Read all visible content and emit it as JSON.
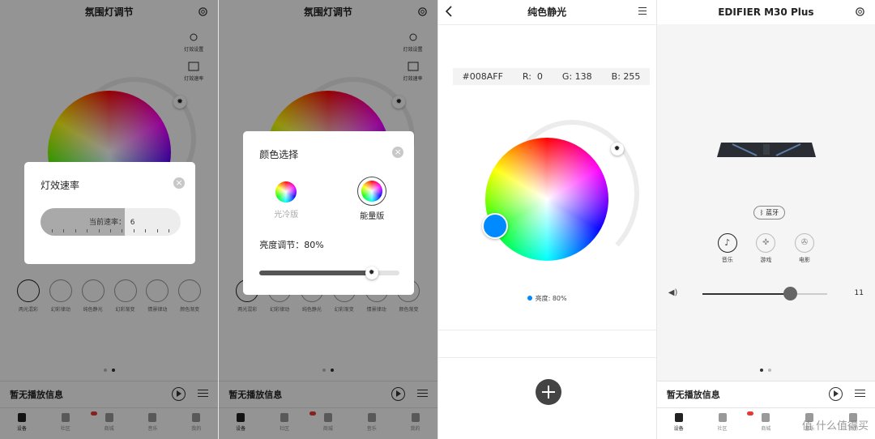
{
  "panel1": {
    "title": "氛围灯调节",
    "side_effect_label": "灯效设置",
    "side_speed_label": "灯效速率",
    "modes": [
      "两光混彩",
      "幻彩律动",
      "纯色静光",
      "幻彩渐变",
      "情景律动",
      "颜色渐变"
    ],
    "dialog": {
      "title": "灯效速率",
      "speed_label": "当前速率：",
      "speed_value": "6",
      "speed_fraction": 0.6
    },
    "player": {
      "text": "暂无播放信息"
    },
    "tabs": [
      "设备",
      "社区",
      "商城",
      "音乐",
      "我的"
    ]
  },
  "panel2": {
    "title": "氛围灯调节",
    "dialog": {
      "title": "颜色选择",
      "option_cold": "光冷版",
      "option_energy": "能量版",
      "brightness_label": "亮度调节：",
      "brightness_value": "80%",
      "brightness_fraction": 0.8
    },
    "player": {
      "text": "暂无播放信息"
    },
    "tabs": [
      "设备",
      "社区",
      "商城",
      "音乐",
      "我的"
    ]
  },
  "panel3": {
    "title": "纯色静光",
    "hex": "#008AFF",
    "r_label": "R:",
    "r_value": "0",
    "g_label": "G:",
    "g_value": "138",
    "b_label": "B:",
    "b_value": "255",
    "selected_color": "#008AFF",
    "brightness_text": "亮度: 80%"
  },
  "panel4": {
    "title": "EDIFIER M30 Plus",
    "bluetooth": "蓝牙",
    "modes": [
      "音乐",
      "游戏",
      "电影"
    ],
    "volume_value": "11",
    "volume_fraction": 0.7,
    "player": {
      "text": "暂无播放信息"
    },
    "tabs": [
      "设备",
      "社区",
      "商城",
      "音乐",
      "我的"
    ]
  },
  "watermark": "值 什么值得买"
}
